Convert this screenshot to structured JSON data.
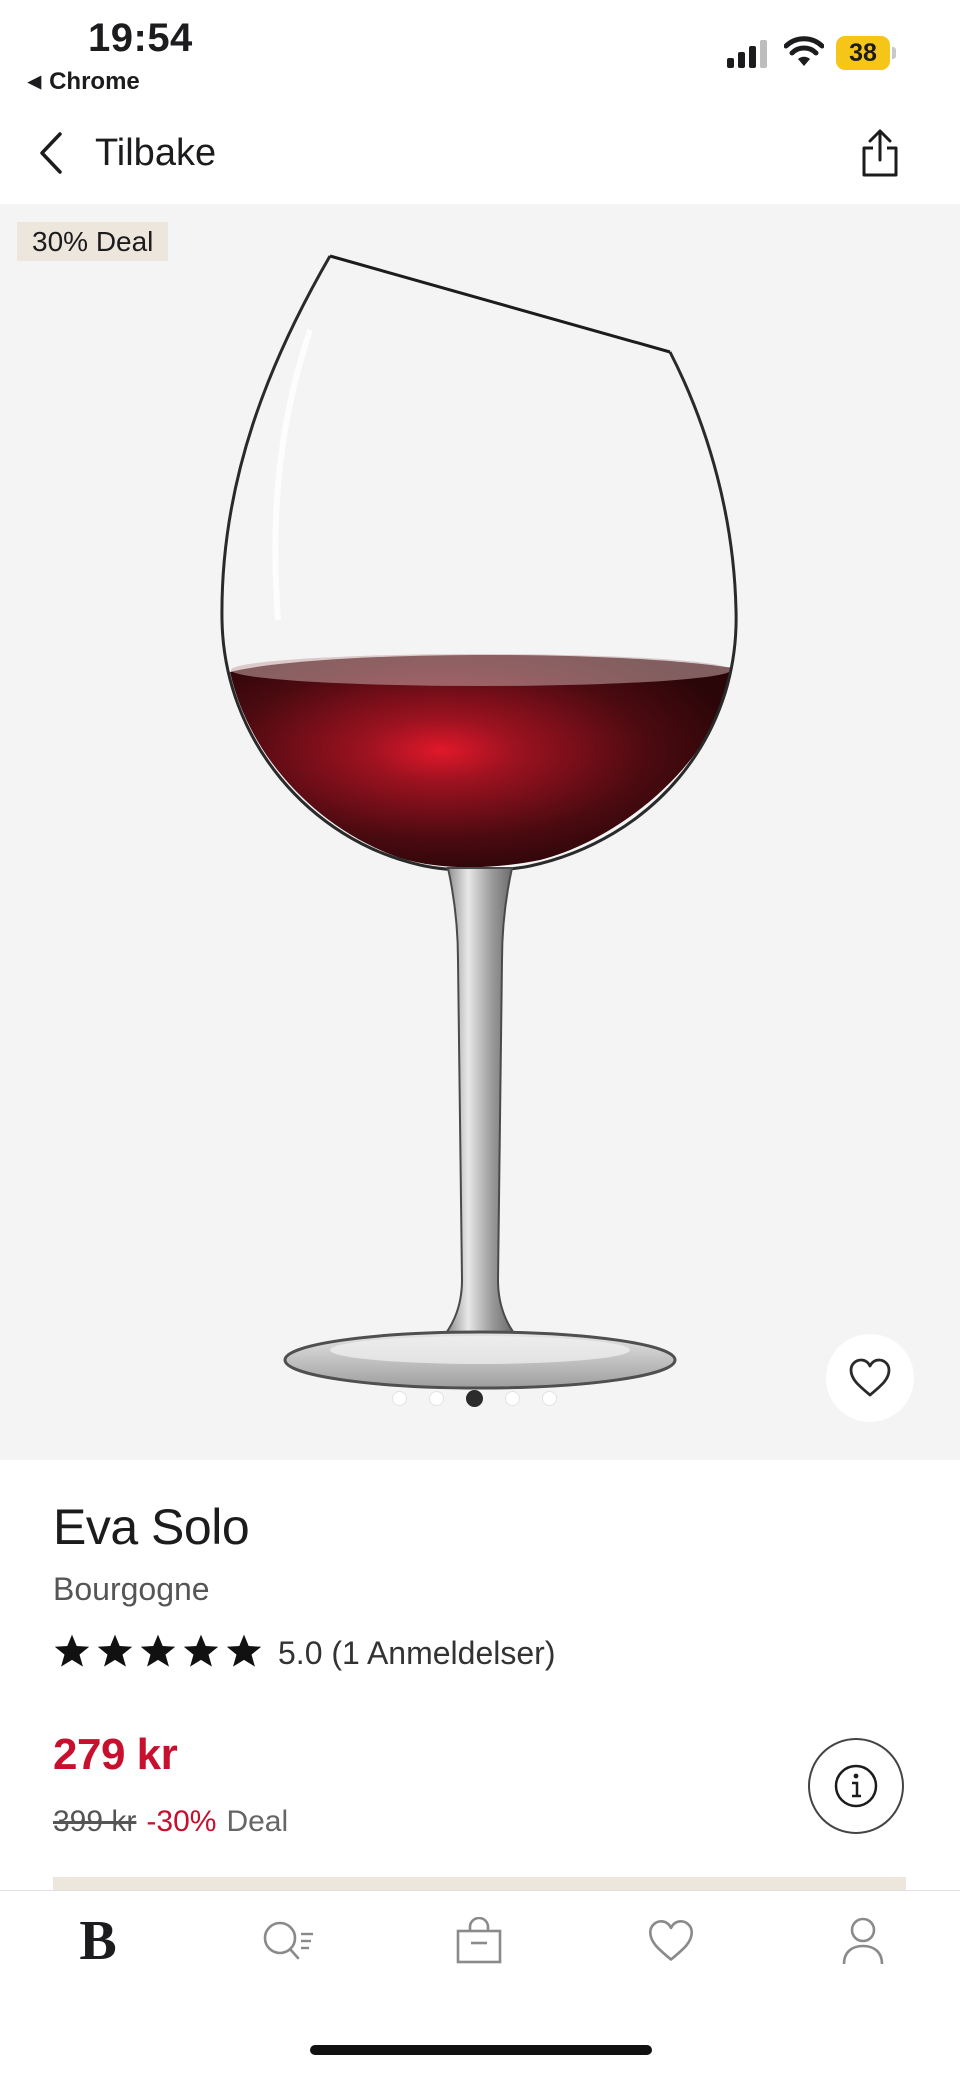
{
  "status_bar": {
    "time": "19:54",
    "back_app": "Chrome",
    "battery": "38",
    "battery_color": "#f5c518"
  },
  "nav": {
    "back_label": "Tilbake",
    "back_icon": "chevron-left-icon",
    "share_icon": "share-icon"
  },
  "product_image": {
    "badge": "30% Deal",
    "image_count": 5,
    "active_index": 2,
    "background": "#f4f4f4"
  },
  "product": {
    "brand": "Eva Solo",
    "model": "Bourgogne",
    "stars": 5,
    "rating_text": "5.0 (1 Anmeldelser)",
    "price": "279 kr",
    "old_price": "399 kr",
    "discount": "-30%",
    "deal_label": "Deal",
    "price_color": "#c8102e"
  },
  "tabbar": {
    "home_logo": "B",
    "items": [
      "home-logo",
      "search-icon",
      "shopping-bag-icon",
      "heart-icon",
      "user-icon"
    ]
  }
}
